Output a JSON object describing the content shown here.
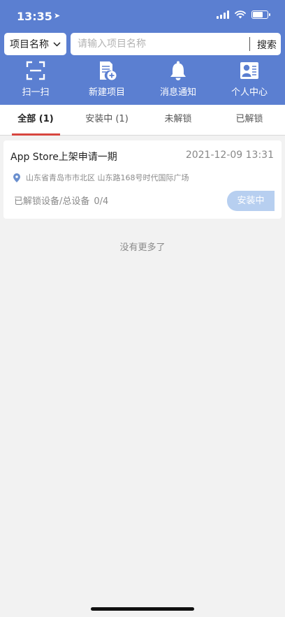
{
  "status_bar": {
    "time": "13:35",
    "location_icon": "location-arrow-icon"
  },
  "search": {
    "select_label": "项目名称",
    "placeholder": "请输入项目名称",
    "button_label": "搜索"
  },
  "nav": [
    {
      "label": "扫一扫",
      "icon": "scan-icon"
    },
    {
      "label": "新建项目",
      "icon": "new-document-icon"
    },
    {
      "label": "消息通知",
      "icon": "bell-icon"
    },
    {
      "label": "个人中心",
      "icon": "profile-card-icon"
    }
  ],
  "tabs": [
    {
      "label": "全部 (1)",
      "active": true
    },
    {
      "label": "安装中 (1)",
      "active": false
    },
    {
      "label": "未解锁",
      "active": false
    },
    {
      "label": "已解锁",
      "active": false
    }
  ],
  "project": {
    "title": "App Store上架申请一期",
    "date": "2021-12-09 13:31",
    "address": "山东省青岛市市北区 山东路168号时代国际广场",
    "count_label": "已解锁设备/总设备",
    "count_value": "0/4",
    "status": "安装中"
  },
  "footer_text": "没有更多了",
  "colors": {
    "header": "#5b7fd1",
    "tab_indicator": "#d7463f",
    "status_button": "#b7cff0",
    "background": "#f2f2f2"
  }
}
